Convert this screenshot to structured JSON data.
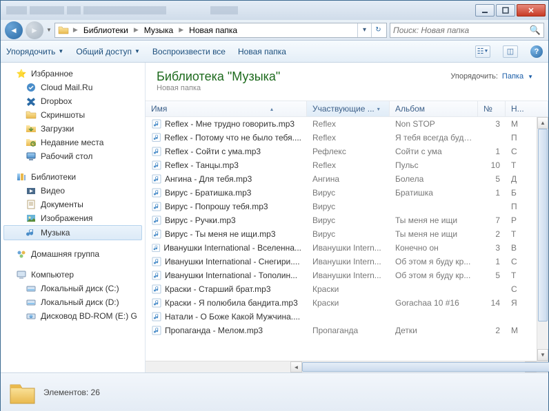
{
  "breadcrumb": {
    "parts": [
      "Библиотеки",
      "Музыка",
      "Новая папка"
    ]
  },
  "search": {
    "placeholder": "Поиск: Новая папка"
  },
  "toolbar": {
    "organize": "Упорядочить",
    "share": "Общий доступ",
    "playall": "Воспроизвести все",
    "newfolder": "Новая папка"
  },
  "sidebar": {
    "favorites": {
      "label": "Избранное",
      "items": [
        "Cloud Mail.Ru",
        "Dropbox",
        "Скриншоты",
        "Загрузки",
        "Недавние места",
        "Рабочий стол"
      ]
    },
    "libraries": {
      "label": "Библиотеки",
      "items": [
        "Видео",
        "Документы",
        "Изображения",
        "Музыка"
      ],
      "selected": 3
    },
    "homegroup": {
      "label": "Домашняя группа"
    },
    "computer": {
      "label": "Компьютер",
      "items": [
        "Локальный диск (C:)",
        "Локальный диск (D:)",
        "Дисковод BD-ROM (E:) G"
      ]
    }
  },
  "main": {
    "title": "Библиотека \"Музыка\"",
    "subtitle": "Новая папка",
    "arrange": {
      "label": "Упорядочить:",
      "value": "Папка"
    },
    "columns": {
      "name": "Имя",
      "artist": "Участвующие ...",
      "album": "Альбом",
      "track": "№",
      "title": "Н..."
    },
    "files": [
      {
        "name": "Reflex - Мне трудно говорить.mp3",
        "artist": "Reflex",
        "album": "Non STOP",
        "track": "3",
        "title": "М"
      },
      {
        "name": "Reflex - Потому что не было тебя....",
        "artist": "Reflex",
        "album": "Я тебя всегда буду ...",
        "track": "",
        "title": "П"
      },
      {
        "name": "Reflex - Сойти с ума.mp3",
        "artist": "Рефлекс",
        "album": "Сойти с ума",
        "track": "1",
        "title": "С"
      },
      {
        "name": "Reflex - Танцы.mp3",
        "artist": "Reflex",
        "album": "Пульс",
        "track": "10",
        "title": "Т"
      },
      {
        "name": "Ангина - Для тебя.mp3",
        "artist": "Ангина",
        "album": "Болела",
        "track": "5",
        "title": "Д"
      },
      {
        "name": "Вирус - Братишка.mp3",
        "artist": "Вирус",
        "album": "Братишка",
        "track": "1",
        "title": "Б"
      },
      {
        "name": "Вирус - Попрошу тебя.mp3",
        "artist": "Вирус",
        "album": "",
        "track": "",
        "title": "П"
      },
      {
        "name": "Вирус - Ручки.mp3",
        "artist": "Вирус",
        "album": "Ты меня не ищи",
        "track": "7",
        "title": "Р"
      },
      {
        "name": "Вирус - Ты меня не ищи.mp3",
        "artist": "Вирус",
        "album": "Ты меня не ищи",
        "track": "2",
        "title": "Т"
      },
      {
        "name": "Иванушки International - Вселенна...",
        "artist": "Иванушки Intern...",
        "album": "Конечно он",
        "track": "3",
        "title": "В"
      },
      {
        "name": "Иванушки International - Снегири....",
        "artist": "Иванушки Intern...",
        "album": "Об этом я буду кр...",
        "track": "1",
        "title": "С"
      },
      {
        "name": "Иванушки International - Тополин...",
        "artist": "Иванушки Intern...",
        "album": "Об этом я буду кр...",
        "track": "5",
        "title": "Т"
      },
      {
        "name": "Краски - Старший брат.mp3",
        "artist": "Краски",
        "album": "",
        "track": "",
        "title": "С"
      },
      {
        "name": "Краски - Я полюбила бандита.mp3",
        "artist": "Краски",
        "album": "Gorachaa 10 #16",
        "track": "14",
        "title": "Я"
      },
      {
        "name": "Натали - О Боже Какой Мужчина....",
        "artist": "",
        "album": "",
        "track": "",
        "title": ""
      },
      {
        "name": "Пропаганда - Мелом.mp3",
        "artist": "Пропаганда",
        "album": "Детки",
        "track": "2",
        "title": "М"
      }
    ]
  },
  "status": {
    "count_label": "Элементов: 26"
  }
}
